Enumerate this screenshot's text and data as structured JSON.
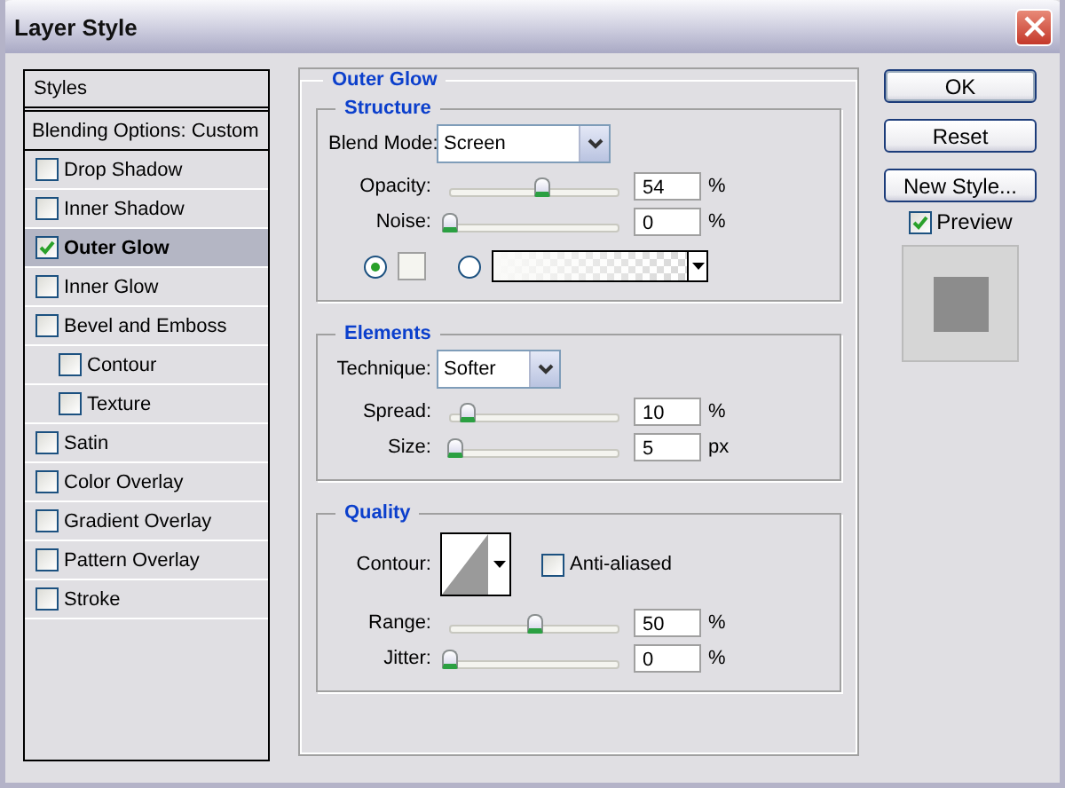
{
  "window": {
    "title": "Layer Style"
  },
  "styles_list": {
    "header": "Styles",
    "items": [
      {
        "label": "Blending Options: Custom",
        "kind": "plain",
        "selected": false
      },
      {
        "label": "Drop Shadow",
        "kind": "check",
        "checked": false,
        "selected": false
      },
      {
        "label": "Inner Shadow",
        "kind": "check",
        "checked": false,
        "selected": false
      },
      {
        "label": "Outer Glow",
        "kind": "check",
        "checked": true,
        "selected": true
      },
      {
        "label": "Inner Glow",
        "kind": "check",
        "checked": false,
        "selected": false
      },
      {
        "label": "Bevel and Emboss",
        "kind": "check",
        "checked": false,
        "selected": false,
        "children": [
          {
            "label": "Contour",
            "kind": "check",
            "checked": false,
            "selected": false
          },
          {
            "label": "Texture",
            "kind": "check",
            "checked": false,
            "selected": false
          }
        ]
      },
      {
        "label": "Satin",
        "kind": "check",
        "checked": false,
        "selected": false
      },
      {
        "label": "Color Overlay",
        "kind": "check",
        "checked": false,
        "selected": false
      },
      {
        "label": "Gradient Overlay",
        "kind": "check",
        "checked": false,
        "selected": false
      },
      {
        "label": "Pattern Overlay",
        "kind": "check",
        "checked": false,
        "selected": false
      },
      {
        "label": "Stroke",
        "kind": "check",
        "checked": false,
        "selected": false
      }
    ]
  },
  "outer_glow": {
    "title": "Outer Glow",
    "structure": {
      "title": "Structure",
      "blend_mode": {
        "label": "Blend Mode:",
        "value": "Screen"
      },
      "sliders": [
        {
          "label": "Opacity:",
          "level": 0.54,
          "value": "54",
          "unit": "%"
        },
        {
          "label": "Noise:",
          "level": 0,
          "value": "0",
          "unit": "%"
        }
      ],
      "sources": [
        {
          "kind": "color",
          "selected": true
        },
        {
          "kind": "gradient",
          "selected": false
        }
      ]
    },
    "elements": {
      "title": "Elements",
      "technique": {
        "label": "Technique:",
        "value": "Softer"
      },
      "sliders": [
        {
          "label": "Spread:",
          "level": 0.1,
          "value": "10",
          "unit": "%"
        },
        {
          "label": "Size:",
          "level": 0.03,
          "value": "5",
          "unit": "px"
        }
      ]
    },
    "quality": {
      "title": "Quality",
      "contour": {
        "label": "Contour:"
      },
      "anti_aliased": {
        "label": "Anti-aliased",
        "checked": false
      },
      "sliders": [
        {
          "label": "Range:",
          "level": 0.5,
          "value": "50",
          "unit": "%"
        },
        {
          "label": "Jitter:",
          "level": 0,
          "value": "0",
          "unit": "%"
        }
      ]
    }
  },
  "buttons": [
    "OK",
    "Reset",
    "New Style..."
  ],
  "preview": {
    "label": "Preview",
    "checked": true
  }
}
